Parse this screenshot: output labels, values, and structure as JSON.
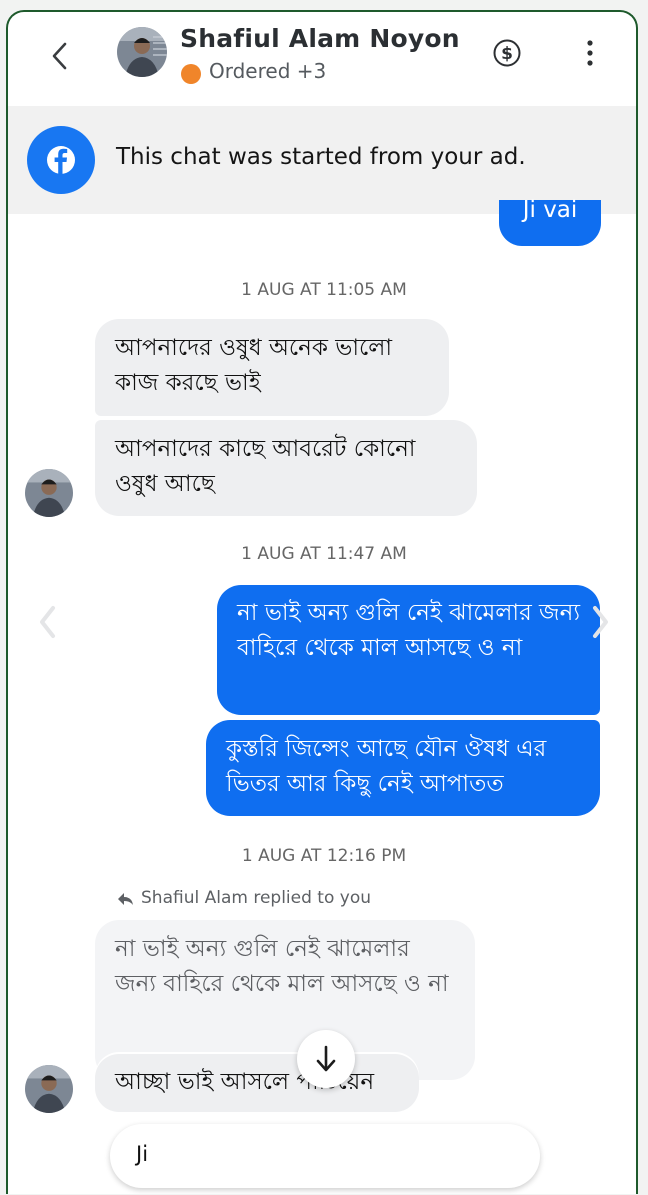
{
  "header": {
    "contact_name": "Shafiul Alam Noyon",
    "status_label": "Ordered +3",
    "status_color": "#f0852a",
    "icons": [
      "back-arrow-icon",
      "dollar-icon",
      "more-vertical-icon"
    ]
  },
  "banner": {
    "text": "This chat was started from your ad.",
    "icon": "facebook-icon",
    "brand_color": "#1877f2"
  },
  "messages": {
    "out_top": "Ji vai",
    "ts1": "1 AUG AT 11:05 AM",
    "in1": "আপনাদের ওষুধ অনেক ভালো কাজ করছে ভাই",
    "in2": "আপনাদের কাছে আবরেট কোনো ওষুধ আছে",
    "ts2": "1 AUG AT 11:47 AM",
    "out1": "না ভাই অন্য গুলি নেই ঝামেলার জন্য বাহিরে থেকে মাল আসছে ও না",
    "out2": "কুস্তরি জিন্সেং আছে যৌন ঔষধ এর ভিতর আর কিছু নেই আপাতত",
    "ts3": "1 AUG AT 12:16 PM",
    "reply_label": "Shafiul Alam replied to you",
    "quoted": "না ভাই অন্য গুলি নেই ঝামেলার জন্য বাহিরে থেকে মাল আসছে ও না",
    "in3": "আচ্ছা ভাই আসলে পাঠিয়েন"
  },
  "composer": {
    "value": "Ji"
  },
  "colors": {
    "outgoing": "#0f6ef0",
    "incoming": "#eeeff1",
    "frame": "#1e5a2c"
  }
}
